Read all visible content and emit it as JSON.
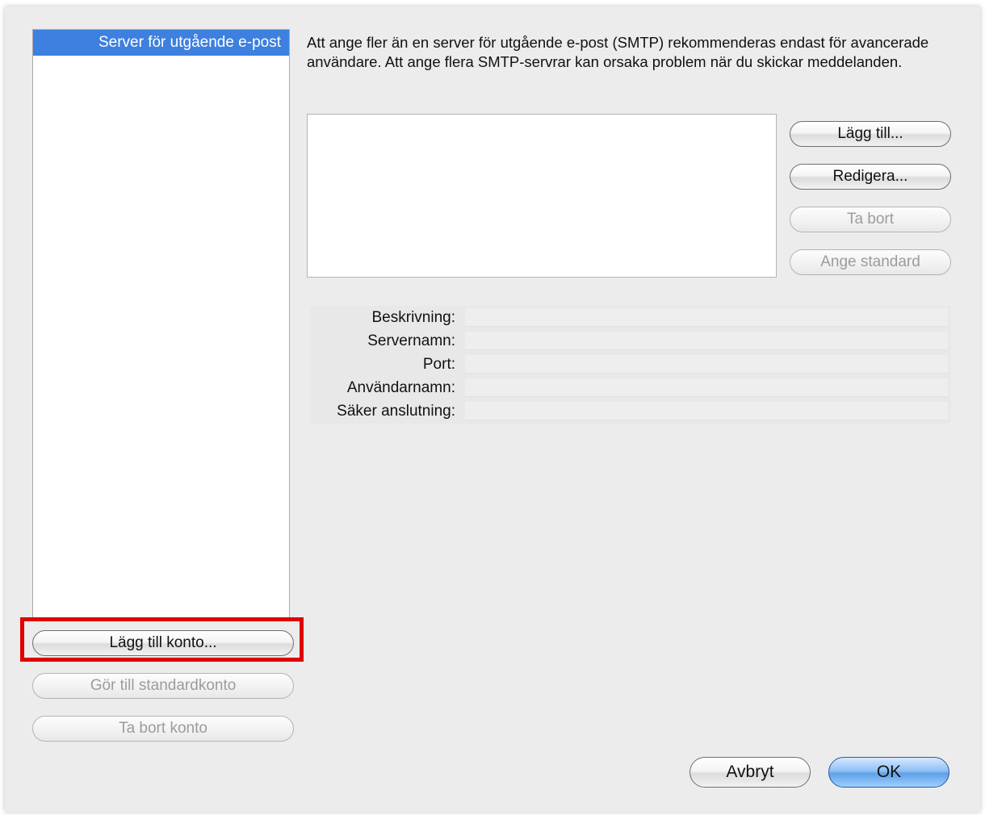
{
  "sidebar": {
    "items": [
      {
        "label": "Server för utgående e-post",
        "selected": true
      }
    ],
    "buttons": {
      "add_account": "Lägg till konto...",
      "make_default_account": "Gör till standardkonto",
      "remove_account": "Ta bort konto"
    }
  },
  "main": {
    "description": "Att ange fler än en server för utgående e-post (SMTP) rekommenderas endast för avancerade användare. Att ange flera SMTP-servrar kan orsaka problem när du skickar meddelanden.",
    "server_buttons": {
      "add": "Lägg till...",
      "edit": "Redigera...",
      "remove": "Ta bort",
      "set_default": "Ange standard"
    },
    "details": [
      {
        "label": "Beskrivning:",
        "value": ""
      },
      {
        "label": "Servernamn:",
        "value": ""
      },
      {
        "label": "Port:",
        "value": ""
      },
      {
        "label": "Användarnamn:",
        "value": ""
      },
      {
        "label": "Säker anslutning:",
        "value": ""
      }
    ]
  },
  "footer": {
    "cancel": "Avbryt",
    "ok": "OK"
  },
  "colors": {
    "selection": "#3d80df",
    "highlight_box": "#e00000",
    "default_button": "#5fa0e8"
  }
}
